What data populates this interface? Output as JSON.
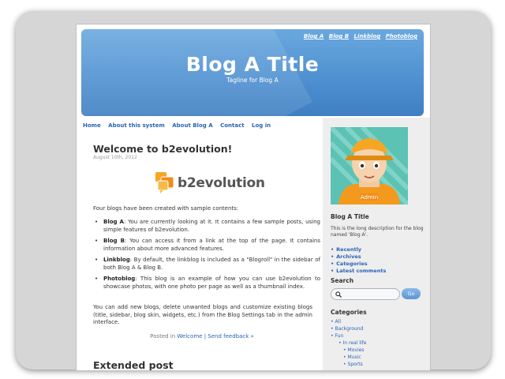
{
  "nav": {
    "blog_links": [
      "Blog A",
      "Blog B",
      "Linkblog",
      "Photoblog"
    ]
  },
  "header": {
    "title": "Blog A Title",
    "tagline": "Tagline for Blog A"
  },
  "menu": [
    "Home",
    "About this system",
    "About Blog A",
    "Contact",
    "Log in"
  ],
  "post": {
    "title": "Welcome to b2evolution!",
    "date": "August 10th, 2012",
    "logo_text": "b2evolution",
    "intro": "Four blogs have been created with sample contents:",
    "items": [
      {
        "name": "Blog A",
        "text": ": You are currently looking at it. It contains a few sample posts, using simple features of b2evolution."
      },
      {
        "name": "Blog B",
        "text": ": You can access it from a link at the top of the page. It contains information about more advanced features."
      },
      {
        "name": "Linkblog",
        "text": ": By default, the linkblog is included as a \"Blogroll\" in the sidebar of both Blog A & Blog B."
      },
      {
        "name": "Photoblog",
        "text": ": This blog is an example of how you can use b2evolution to showcase photos, with one photo per page as well as a thumbnail index."
      }
    ],
    "after": "You can add new blogs, delete unwanted blogs and customize existing blogs (title, sidebar, blog skin, widgets, etc.) from the Blog Settings tab in the admin interface.",
    "posted_in_label": "Posted in",
    "category": "Welcome",
    "separator": "|",
    "feedback": "Send feedback »"
  },
  "post2": {
    "title": "Extended post"
  },
  "sidebar": {
    "avatar_label": "Admin",
    "title": "Blog A Title",
    "description": "This is the long description for the blog named 'Blog A'.",
    "links": [
      "Recently",
      "Archives",
      "Categories",
      "Latest comments"
    ],
    "search_heading": "Search",
    "search_button": "Go",
    "categories_heading": "Categories",
    "categories": [
      {
        "label": "All",
        "level": 1
      },
      {
        "label": "Background",
        "level": 1
      },
      {
        "label": "Fun",
        "level": 1
      },
      {
        "label": "In real life",
        "level": 2
      },
      {
        "label": "Movies",
        "level": 3
      },
      {
        "label": "Music",
        "level": 3
      },
      {
        "label": "Sports",
        "level": 3
      }
    ]
  },
  "colors": {
    "header_blue": "#4d8fd0",
    "link_blue": "#2a64b5",
    "sidebar_bg": "#eeeeee",
    "logo_orange": "#f5a623"
  }
}
